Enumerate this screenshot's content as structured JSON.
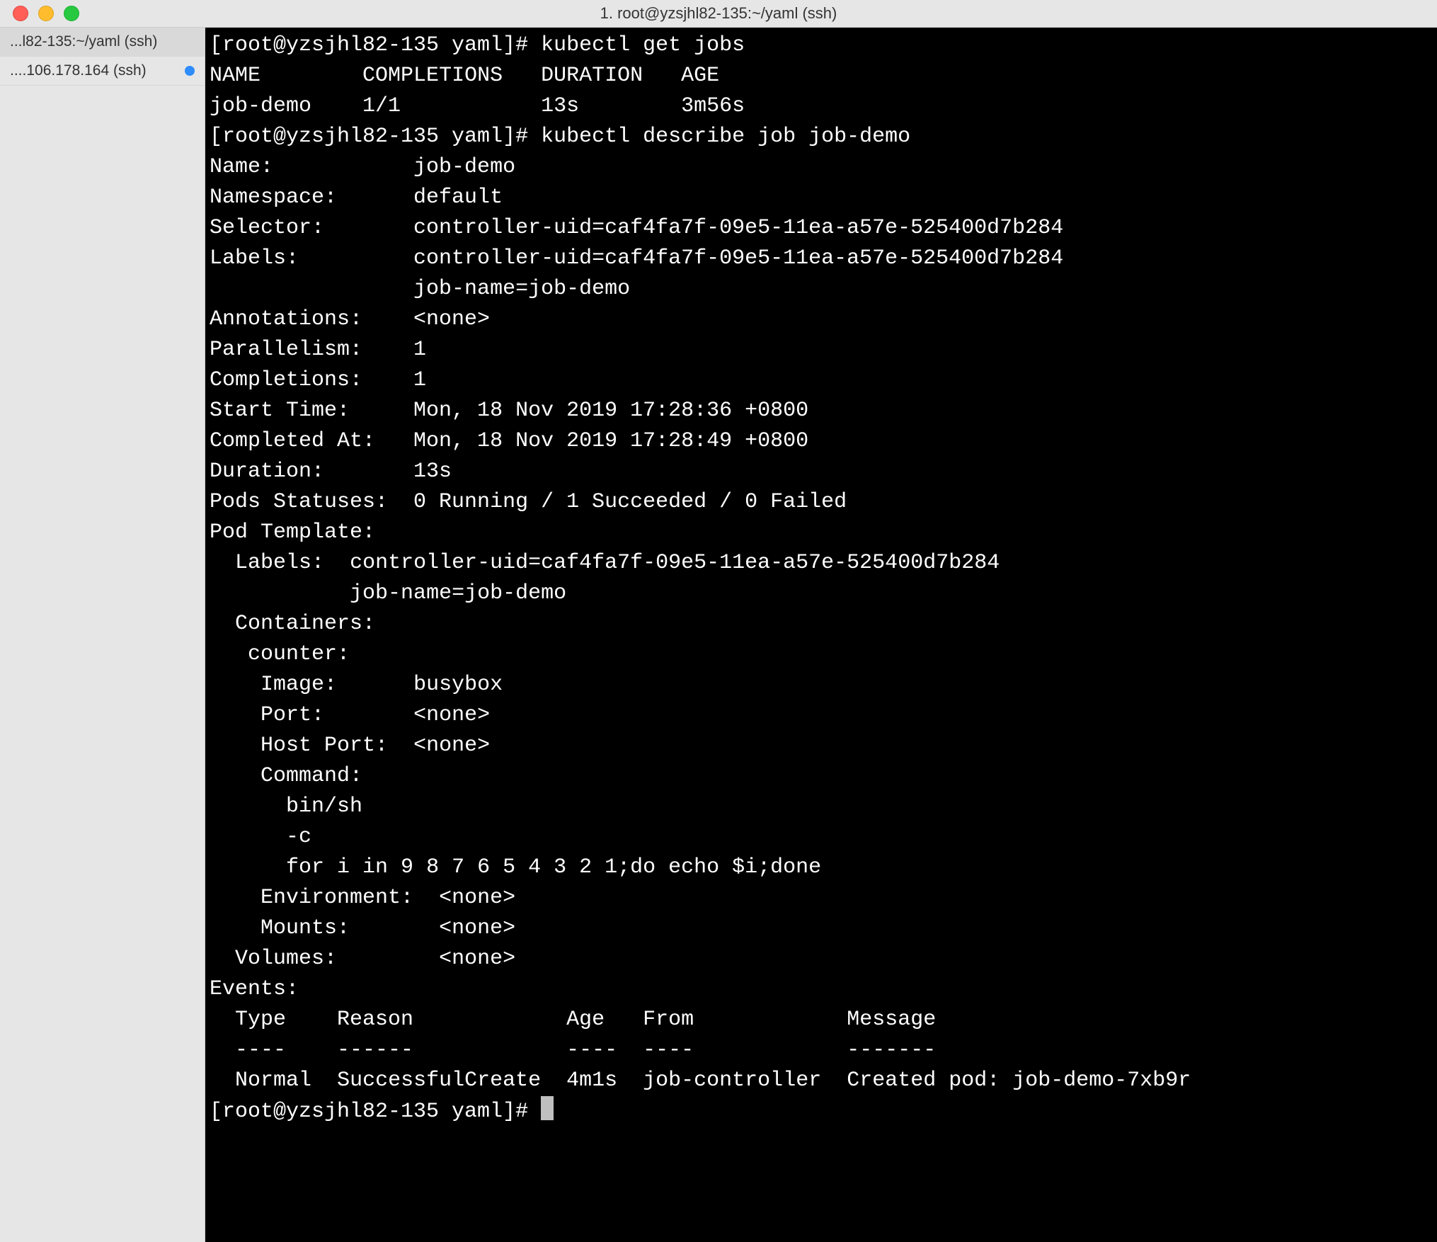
{
  "window": {
    "title": "1. root@yzsjhl82-135:~/yaml (ssh)"
  },
  "sidebar": {
    "tabs": [
      {
        "label": "...l82-135:~/yaml (ssh)",
        "has_dot": false
      },
      {
        "label": "....106.178.164 (ssh)",
        "has_dot": true
      }
    ]
  },
  "prompt": "[root@yzsjhl82-135 yaml]# ",
  "commands": {
    "get_jobs": "kubectl get jobs",
    "describe_job": "kubectl describe job job-demo"
  },
  "get_jobs_output": {
    "header": {
      "name": "NAME",
      "completions": "COMPLETIONS",
      "duration": "DURATION",
      "age": "AGE"
    },
    "row": {
      "name": "job-demo",
      "completions": "1/1",
      "duration": "13s",
      "age": "3m56s"
    }
  },
  "describe": {
    "fields": {
      "Name": "job-demo",
      "Namespace": "default",
      "Selector": "controller-uid=caf4fa7f-09e5-11ea-a57e-525400d7b284",
      "Labels_l1": "controller-uid=caf4fa7f-09e5-11ea-a57e-525400d7b284",
      "Labels_l2": "job-name=job-demo",
      "Annotations": "<none>",
      "Parallelism": "1",
      "Completions": "1",
      "Start Time": "Mon, 18 Nov 2019 17:28:36 +0800",
      "Completed At": "Mon, 18 Nov 2019 17:28:49 +0800",
      "Duration": "13s",
      "Pods Statuses": "0 Running / 1 Succeeded / 0 Failed"
    },
    "pod_template": {
      "header": "Pod Template:",
      "labels_header": "Labels:",
      "labels_l1": "controller-uid=caf4fa7f-09e5-11ea-a57e-525400d7b284",
      "labels_l2": "job-name=job-demo",
      "containers_header": "Containers:",
      "container_name": "counter:",
      "image_label": "Image:",
      "image_value": "busybox",
      "port_label": "Port:",
      "port_value": "<none>",
      "hostport_label": "Host Port:",
      "hostport_value": "<none>",
      "command_header": "Command:",
      "command_lines": [
        "bin/sh",
        "-c",
        "for i in 9 8 7 6 5 4 3 2 1;do echo $i;done"
      ],
      "env_label": "Environment:",
      "env_value": "<none>",
      "mounts_label": "Mounts:",
      "mounts_value": "<none>",
      "volumes_label": "Volumes:",
      "volumes_value": "<none>"
    },
    "events": {
      "header": "Events:",
      "cols": {
        "type": "Type",
        "reason": "Reason",
        "age": "Age",
        "from": "From",
        "message": "Message"
      },
      "sep": {
        "type": "----",
        "reason": "------",
        "age": "----",
        "from": "----",
        "message": "-------"
      },
      "row": {
        "type": "Normal",
        "reason": "SuccessfulCreate",
        "age": "4m1s",
        "from": "job-controller",
        "message": "Created pod: job-demo-7xb9r"
      }
    }
  }
}
